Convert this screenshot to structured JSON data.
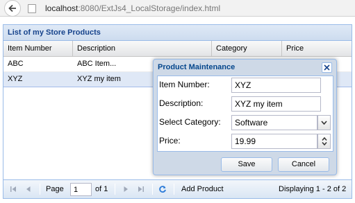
{
  "browser": {
    "url_host": "localhost",
    "url_rest": ":8080/ExtJs4_LocalStorage/index.html"
  },
  "panel": {
    "title": "List of my Store Products",
    "columns": [
      "Item Number",
      "Description",
      "Category",
      "Price"
    ],
    "rows": [
      {
        "item_number": "ABC",
        "description": "ABC Item..."
      },
      {
        "item_number": "XYZ",
        "description": "XYZ my item"
      }
    ]
  },
  "toolbar": {
    "page_label": "Page",
    "page_value": "1",
    "of_label": "of 1",
    "add_product_label": "Add Product",
    "displaying_text": "Displaying 1 - 2 of 2"
  },
  "window": {
    "title": "Product Maintenance",
    "fields": {
      "item_number_label": "Item Number:",
      "item_number_value": "XYZ",
      "description_label": "Description:",
      "description_value": "XYZ my item",
      "category_label": "Select Category:",
      "category_value": "Software",
      "price_label": "Price:",
      "price_value": "19.99"
    },
    "save_label": "Save",
    "cancel_label": "Cancel"
  },
  "icons": [
    "back-arrow-icon",
    "page-icon",
    "first-page-icon",
    "prev-page-icon",
    "next-page-icon",
    "last-page-icon",
    "refresh-icon",
    "close-icon",
    "chevron-down-icon",
    "spinner-up-icon",
    "spinner-down-icon"
  ],
  "colors": {
    "header_text": "#15428b",
    "panel_border": "#99bbe8",
    "selected_row": "#dfe8f6",
    "window_bg": "#ced9e7"
  }
}
